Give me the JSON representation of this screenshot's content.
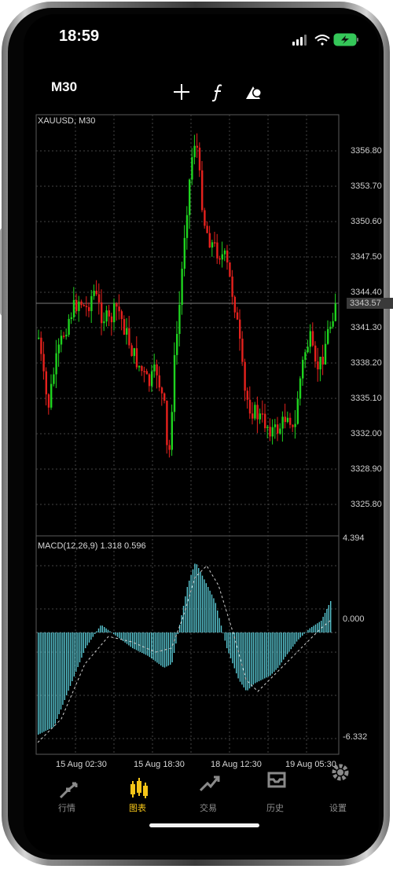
{
  "status_bar": {
    "time": "18:59"
  },
  "toolbar": {
    "timeframe": "M30",
    "tools": [
      {
        "icon": "crosshair-icon"
      },
      {
        "icon": "function-icon"
      },
      {
        "icon": "objects-icon"
      }
    ]
  },
  "chart": {
    "symbol_label": "XAUUSD, M30",
    "price_ticks": [
      "3356.80",
      "3353.70",
      "3350.60",
      "3347.50",
      "3344.40",
      "3341.30",
      "3338.20",
      "3335.10",
      "3332.00",
      "3328.90",
      "3325.80"
    ],
    "current_price": "3343.57",
    "macd": {
      "label": "MACD(12,26,9) 1.318 0.596",
      "scale_top": "4.394",
      "scale_zero": "0.000",
      "scale_bottom": "-6.332"
    },
    "time_labels": [
      "15 Aug 02:30",
      "15 Aug 18:30",
      "18 Aug 12:30",
      "19 Aug 05:30"
    ]
  },
  "bottom_nav": {
    "items": [
      {
        "label": "行情",
        "icon": "quotes-icon",
        "active": false
      },
      {
        "label": "图表",
        "icon": "chart-candles-icon",
        "active": true
      },
      {
        "label": "交易",
        "icon": "trade-icon",
        "active": false
      },
      {
        "label": "历史",
        "icon": "history-icon",
        "active": false
      },
      {
        "label": "设置",
        "icon": "settings-icon",
        "active": false
      }
    ]
  },
  "colors": {
    "bull": "#1fd31f",
    "bear": "#e5211d",
    "macd_hist": "#58c6d1",
    "active": "#f5c518"
  }
}
